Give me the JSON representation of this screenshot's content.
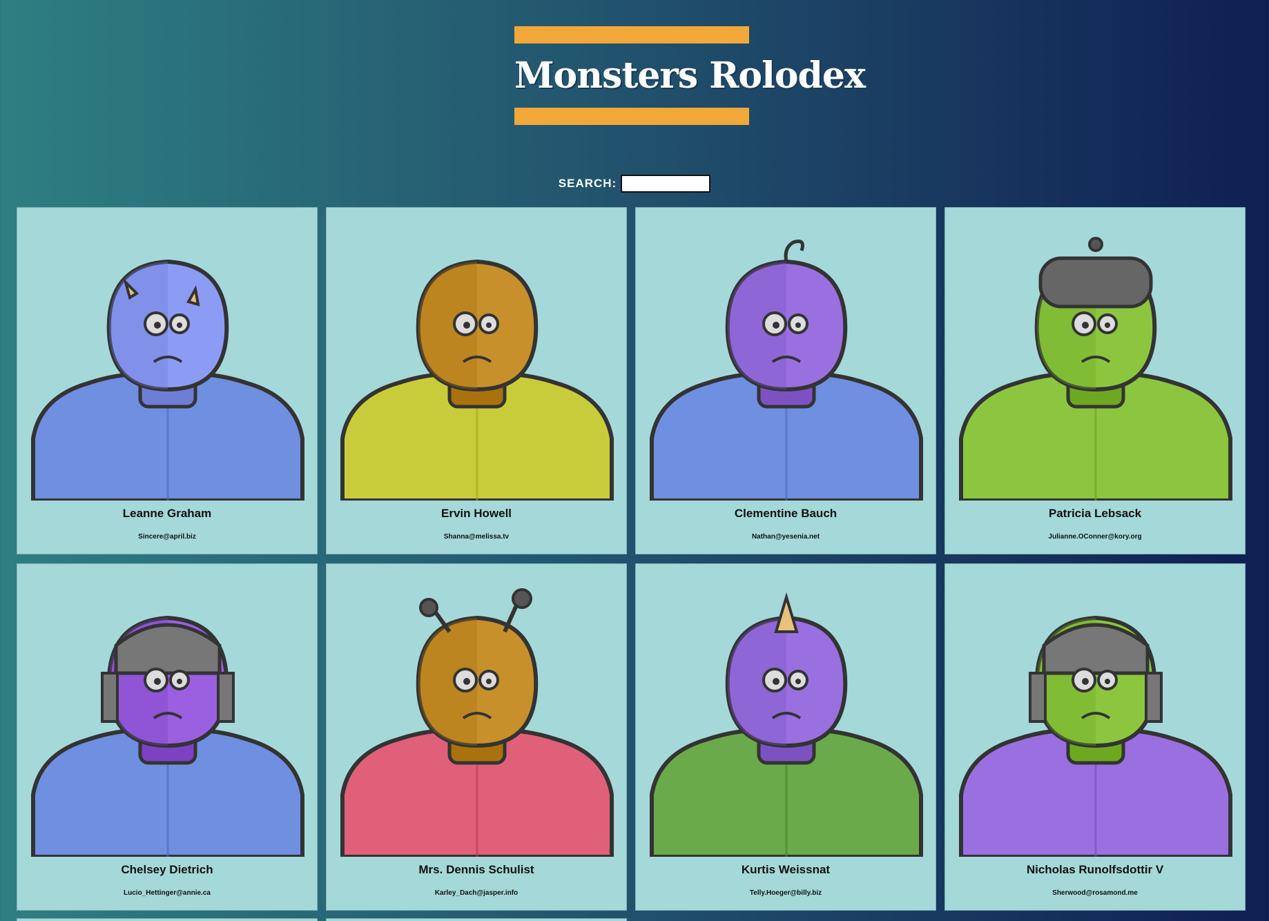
{
  "header": {
    "title": "Monsters Rolodex"
  },
  "search": {
    "label": "SEARCH:",
    "value": "",
    "placeholder": ""
  },
  "colors": {
    "accent": "#f2a838",
    "card_bg": "#a5d8d9",
    "bg_start": "#2e7f82",
    "bg_end": "#0f1f52"
  },
  "monsters": [
    {
      "name": "Leanne Graham",
      "email": "Sincere@april.biz",
      "skin": "#8c9cf5",
      "body": "#6f8fe0",
      "icon": "horned-monster-icon"
    },
    {
      "name": "Ervin Howell",
      "email": "Shanna@melissa.tv",
      "skin": "#c8902a",
      "body": "#c9cc3a",
      "icon": "grinning-monster-icon"
    },
    {
      "name": "Clementine Bauch",
      "email": "Nathan@yesenia.net",
      "skin": "#9a70e0",
      "body": "#6f8fe0",
      "icon": "three-eyed-monster-icon"
    },
    {
      "name": "Patricia Lebsack",
      "email": "Julianne.OConner@kory.org",
      "skin": "#8cc63f",
      "body": "#8cc63f",
      "icon": "helmet-monster-icon"
    },
    {
      "name": "Chelsey Dietrich",
      "email": "Lucio_Hettinger@annie.ca",
      "skin": "#9a60e0",
      "body": "#6f8fe0",
      "icon": "robot-helmet-monster-icon"
    },
    {
      "name": "Mrs. Dennis Schulist",
      "email": "Karley_Dach@jasper.info",
      "skin": "#c8902a",
      "body": "#e0607a",
      "icon": "antenna-monster-icon"
    },
    {
      "name": "Kurtis Weissnat",
      "email": "Telly.Hoeger@billy.biz",
      "skin": "#9a70e0",
      "body": "#6aaa4a",
      "icon": "unicorn-monster-icon"
    },
    {
      "name": "Nicholas Runolfsdottir V",
      "email": "Sherwood@rosamond.me",
      "skin": "#8cc63f",
      "body": "#9a70e0",
      "icon": "green-robot-monster-icon"
    }
  ]
}
